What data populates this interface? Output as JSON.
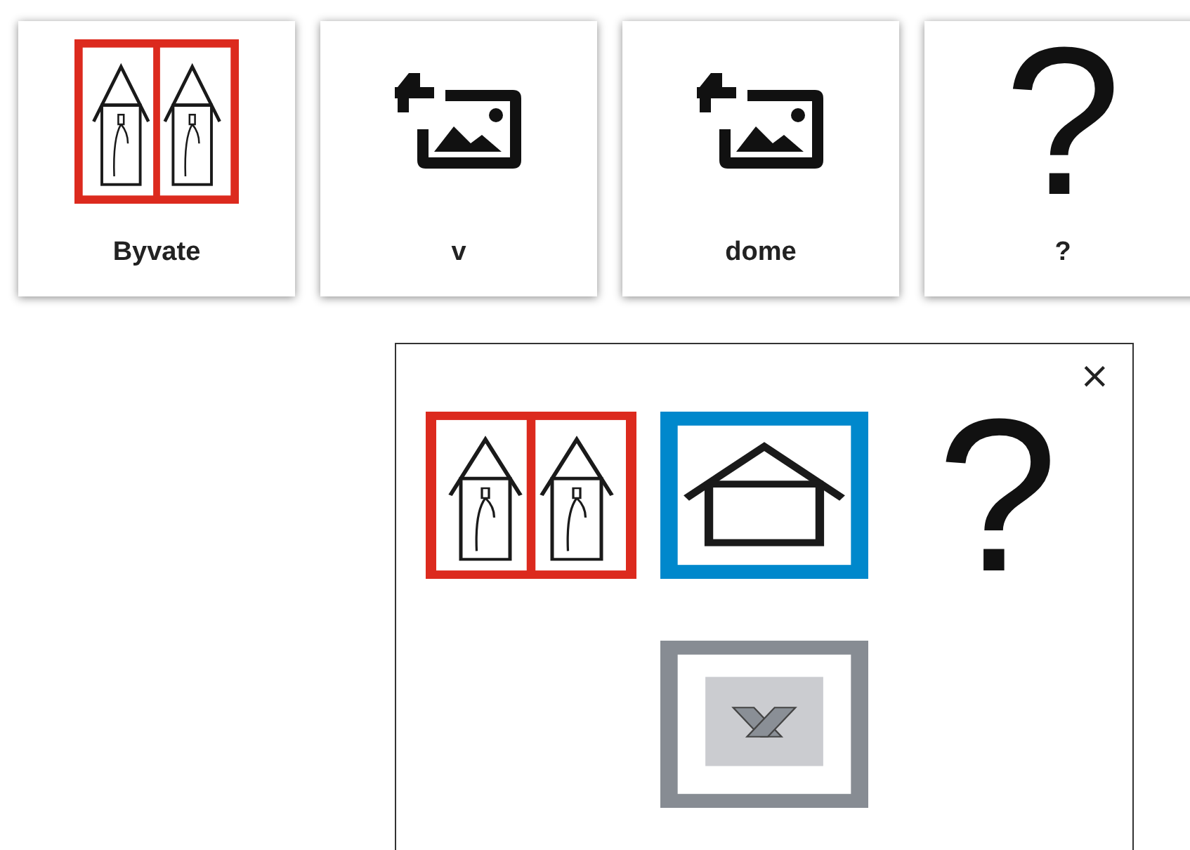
{
  "cards": [
    {
      "kind": "two-houses",
      "label": "Byvate",
      "color": "#dc2a1e"
    },
    {
      "kind": "add-image",
      "label": "v"
    },
    {
      "kind": "add-image",
      "label": "dome"
    },
    {
      "kind": "glyph",
      "glyph": "?",
      "label": "?"
    }
  ],
  "popup": {
    "close": "×",
    "options": [
      {
        "kind": "two-houses",
        "color": "#dc2a1e"
      },
      {
        "kind": "house",
        "color": "#0088cc"
      },
      {
        "kind": "glyph",
        "glyph": "?"
      },
      {
        "kind": "cross",
        "color": "#878c93"
      }
    ]
  }
}
